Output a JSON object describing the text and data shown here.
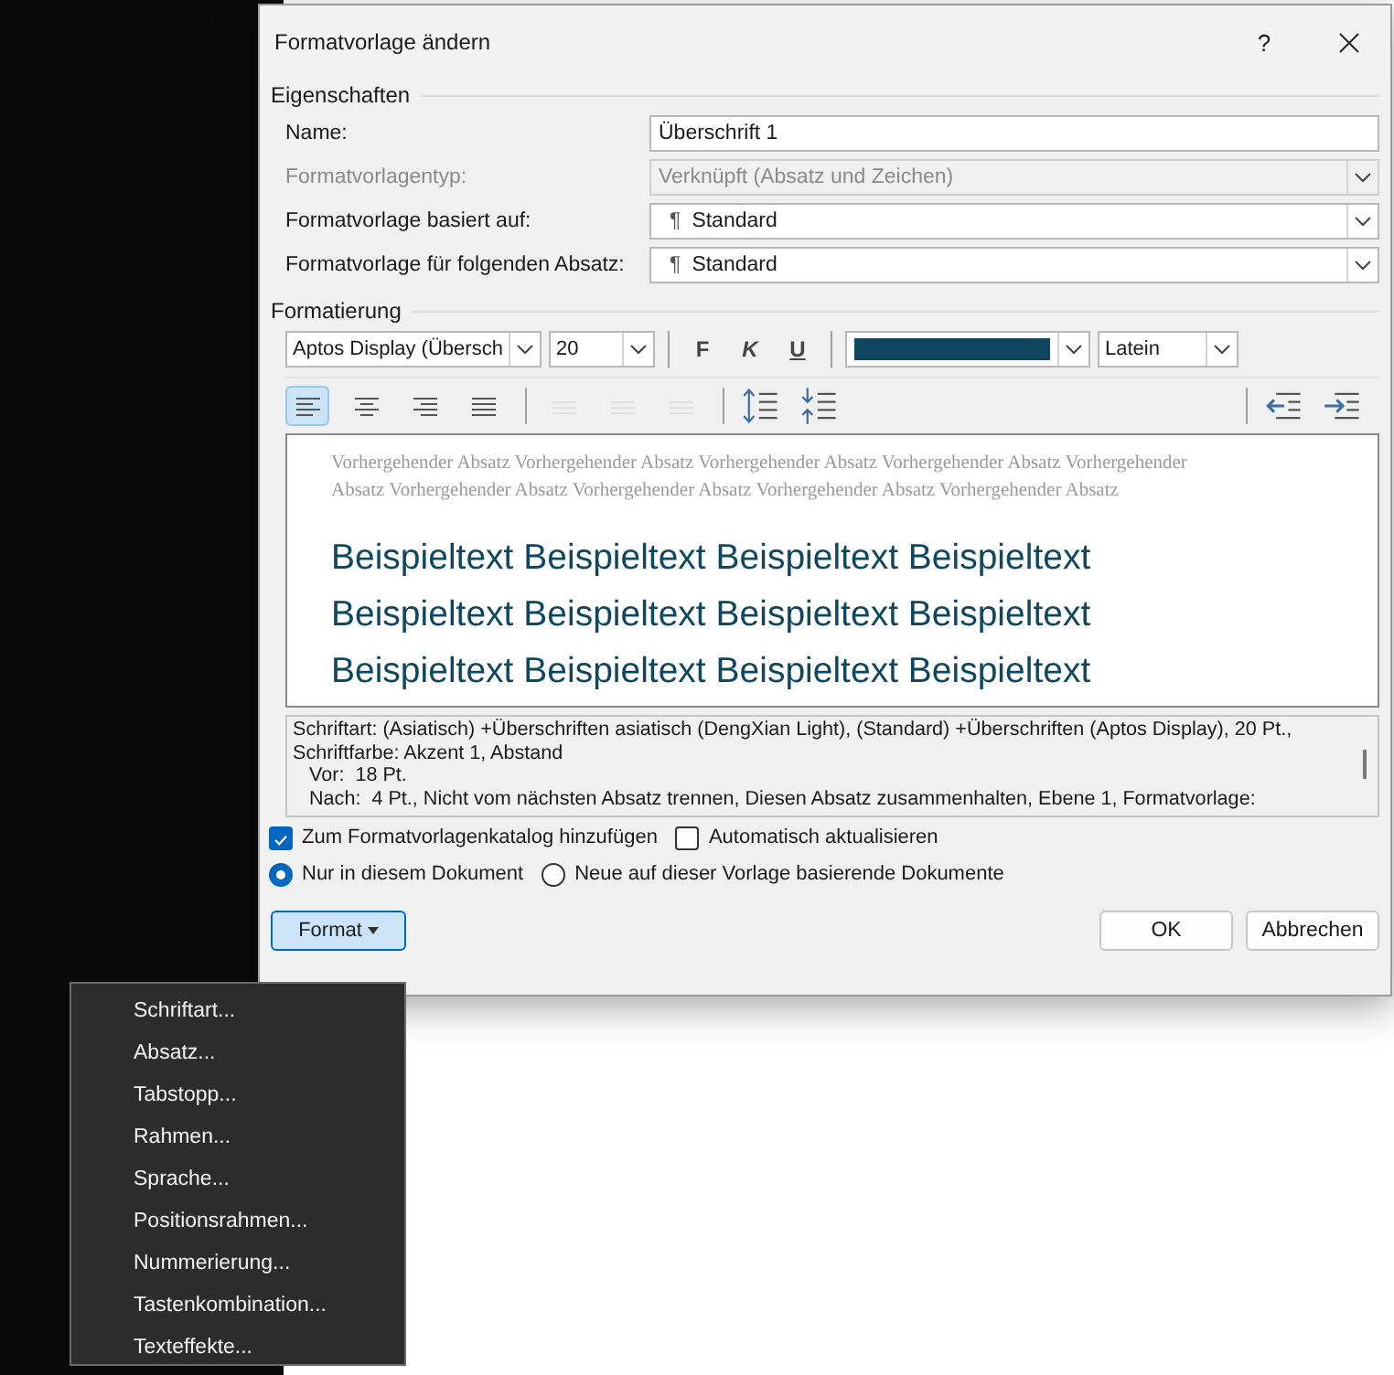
{
  "window": {
    "title": "Formatvorlage ändern",
    "help": "?"
  },
  "properties": {
    "heading": "Eigenschaften",
    "fields": [
      {
        "label": "Name:",
        "value": "Überschrift 1",
        "kind": "text",
        "disabled": false
      },
      {
        "label": "Formatvorlagentyp:",
        "value": "Verknüpft (Absatz und Zeichen)",
        "kind": "dropdown",
        "disabled": true
      },
      {
        "label": "Formatvorlage basiert auf:",
        "value": "Standard",
        "marker": "¶",
        "kind": "dropdown",
        "disabled": false
      },
      {
        "label": "Formatvorlage für folgenden Absatz:",
        "value": "Standard",
        "marker": "¶",
        "kind": "dropdown",
        "disabled": false
      }
    ]
  },
  "formatting": {
    "heading": "Formatierung",
    "font": "Aptos Display (Übersch",
    "size": "20",
    "bold": "F",
    "italic": "K",
    "underline": "U",
    "script": "Latein",
    "align_buttons": [
      {
        "kind": "left",
        "selected": true,
        "disabled": false
      },
      {
        "kind": "center",
        "selected": false,
        "disabled": false
      },
      {
        "kind": "right",
        "selected": false,
        "disabled": false
      },
      {
        "kind": "justify",
        "selected": false,
        "disabled": false
      },
      {
        "kind": "lines",
        "selected": false,
        "disabled": true
      },
      {
        "kind": "lines",
        "selected": false,
        "disabled": true
      },
      {
        "kind": "lines",
        "selected": false,
        "disabled": true
      }
    ]
  },
  "preview": {
    "previous_lines": [
      "Vorhergehender Absatz Vorhergehender Absatz Vorhergehender Absatz Vorhergehender Absatz Vorhergehender",
      "Absatz Vorhergehender Absatz Vorhergehender Absatz Vorhergehender Absatz Vorhergehender Absatz"
    ],
    "sample_lines": [
      "Beispieltext Beispieltext Beispieltext Beispieltext",
      "Beispieltext Beispieltext Beispieltext Beispieltext",
      "Beispieltext Beispieltext Beispieltext Beispieltext"
    ]
  },
  "description": [
    "Schriftart: (Asiatisch) +Überschriften asiatisch (DengXian Light), (Standard) +Überschriften (Aptos Display), 20 Pt.,",
    "Schriftfarbe: Akzent 1, Abstand",
    "   Vor:  18 Pt.",
    "   Nach:  4 Pt., Nicht vom nächsten Absatz trennen, Diesen Absatz zusammenhalten, Ebene 1, Formatvorlage:"
  ],
  "checkboxes": [
    {
      "label": "Zum Formatvorlagenkatalog hinzufügen",
      "checked": true
    },
    {
      "label": "Automatisch aktualisieren",
      "checked": false
    }
  ],
  "radios": [
    {
      "label": "Nur in diesem Dokument",
      "selected": true
    },
    {
      "label": "Neue auf dieser Vorlage basierende Dokumente",
      "selected": false
    }
  ],
  "buttons": {
    "format": "Format",
    "ok": "OK",
    "cancel": "Abbrechen"
  },
  "format_menu": {
    "items": [
      "Schriftart...",
      "Absatz...",
      "Tabstopp...",
      "Rahmen...",
      "Sprache...",
      "Positionsrahmen...",
      "Nummerierung...",
      "Tastenkombination...",
      "Texteffekte..."
    ]
  }
}
